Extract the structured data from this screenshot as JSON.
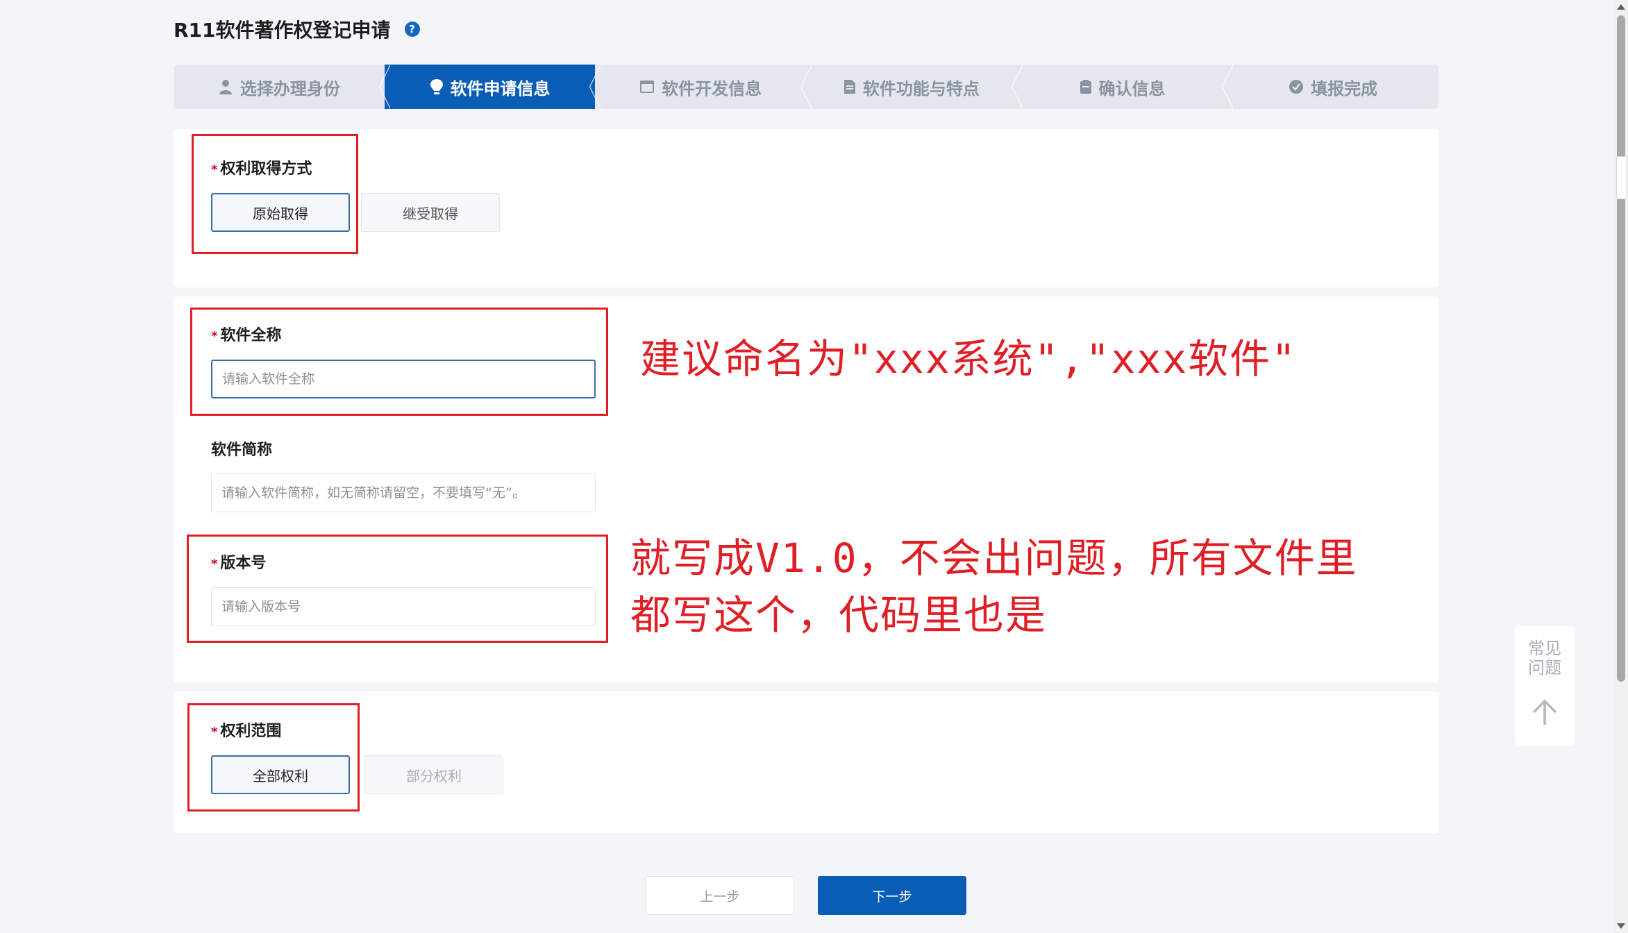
{
  "header": {
    "title": "R11软件著作权登记申请",
    "help_icon": "question-circle-icon"
  },
  "steps": [
    {
      "label": "选择办理身份",
      "icon": "user-icon",
      "state": "done"
    },
    {
      "label": "软件申请信息",
      "icon": "lightbulb-icon",
      "state": "active"
    },
    {
      "label": "软件开发信息",
      "icon": "code-window-icon",
      "state": "pending"
    },
    {
      "label": "软件功能与特点",
      "icon": "document-icon",
      "state": "pending"
    },
    {
      "label": "确认信息",
      "icon": "clipboard-icon",
      "state": "pending"
    },
    {
      "label": "填报完成",
      "icon": "check-circle-icon",
      "state": "pending"
    }
  ],
  "rights_acquisition": {
    "label": "权利取得方式",
    "required_mark": "*",
    "options": [
      "原始取得",
      "继受取得"
    ],
    "selected": "原始取得"
  },
  "software_full_name": {
    "label": "软件全称",
    "required_mark": "*",
    "placeholder": "请输入软件全称",
    "value": ""
  },
  "software_short_name": {
    "label": "软件简称",
    "placeholder": "请输入软件简称，如无简称请留空，不要填写“无”。",
    "value": ""
  },
  "version": {
    "label": "版本号",
    "required_mark": "*",
    "placeholder": "请输入版本号",
    "value": ""
  },
  "rights_scope": {
    "label": "权利范围",
    "required_mark": "*",
    "options": [
      "全部权利",
      "部分权利"
    ],
    "selected": "全部权利"
  },
  "annotations": {
    "naming": "建议命名为\"xxx系统\",\"xxx软件\"",
    "version_line1": "就写成V1.0，不会出问题，所有文件里",
    "version_line2": "都写这个，代码里也是",
    "color": "#e01e25"
  },
  "footer": {
    "prev_label": "上一步",
    "next_label": "下一步"
  },
  "faq": {
    "label": "常见问题",
    "icon": "arrow-up-icon"
  },
  "colors": {
    "primary": "#0a5db4",
    "annotation_red": "#e01e25"
  }
}
